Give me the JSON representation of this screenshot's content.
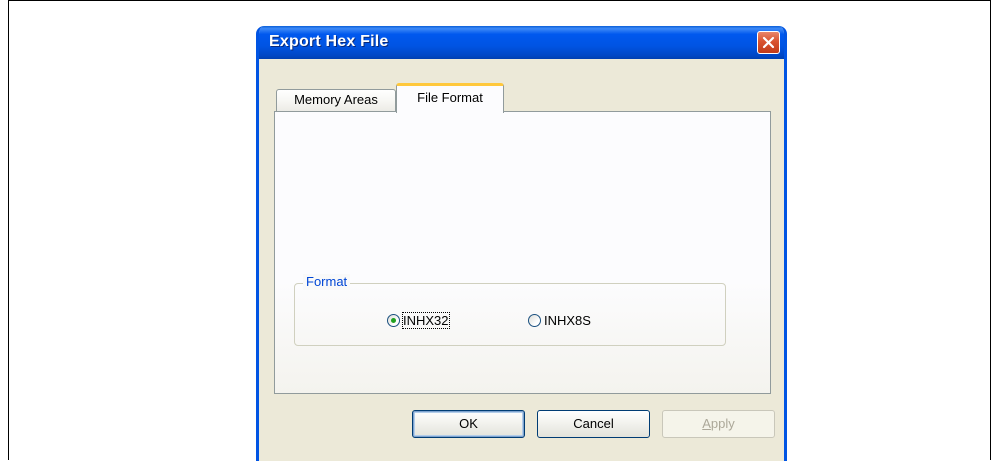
{
  "window": {
    "title": "Export Hex File",
    "close_icon": "close-icon"
  },
  "tabs": [
    {
      "label": "Memory Areas",
      "active": false
    },
    {
      "label": "File Format",
      "active": true
    }
  ],
  "format_group": {
    "label": "Format",
    "options": [
      {
        "label": "INHX32",
        "selected": true
      },
      {
        "label": "INHX8S",
        "selected": false
      }
    ]
  },
  "buttons": {
    "ok": "OK",
    "cancel": "Cancel",
    "apply_first": "A",
    "apply_rest": "pply"
  },
  "colors": {
    "titlebar": "#0054e3",
    "active_tab_highlight": "#ffc83c",
    "group_label": "#0046d5",
    "radio_dot": "#21a121"
  }
}
